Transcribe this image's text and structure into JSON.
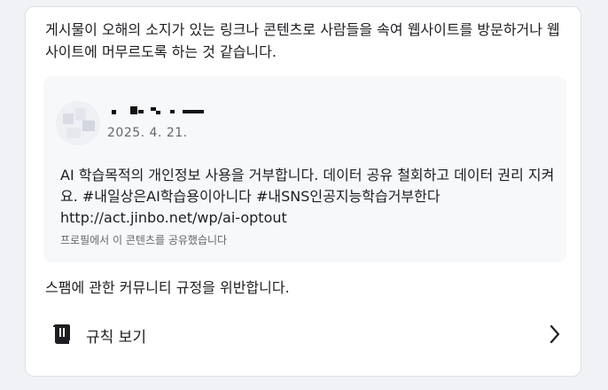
{
  "report": {
    "warning_text": "게시물이 오해의 소지가 있는 링크나 콘텐츠로 사람들을 속여 웹사이트를 방문하거나 웹사이트에 머무르도록 하는 것 같습니다.",
    "post": {
      "date": "2025. 4. 21.",
      "body": "AI 학습목적의 개인정보 사용을 거부합니다. 데이터 공유 철회하고 데이터 권리 지켜요. #내일상은AI학습용이아니다 #내SNS인공지능학습거부한다",
      "link": "http://act.jinbo.net/wp/ai-optout",
      "shared_note": "프로필에서 이 콘텐츠를 공유했습니다"
    },
    "rule_text": "스팸에 관한 커뮤니티 규정을 위반합니다.",
    "rules_button_label": "규칙 보기",
    "icons": {
      "rules": "book-icon",
      "open": "chevron-right-icon"
    }
  }
}
